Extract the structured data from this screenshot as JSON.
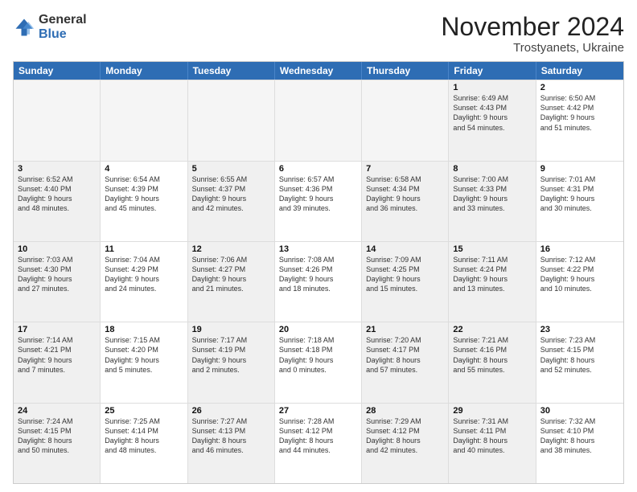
{
  "logo": {
    "general": "General",
    "blue": "Blue"
  },
  "title": "November 2024",
  "subtitle": "Trostyanets, Ukraine",
  "header_days": [
    "Sunday",
    "Monday",
    "Tuesday",
    "Wednesday",
    "Thursday",
    "Friday",
    "Saturday"
  ],
  "rows": [
    [
      {
        "day": "",
        "info": "",
        "empty": true
      },
      {
        "day": "",
        "info": "",
        "empty": true
      },
      {
        "day": "",
        "info": "",
        "empty": true
      },
      {
        "day": "",
        "info": "",
        "empty": true
      },
      {
        "day": "",
        "info": "",
        "empty": true
      },
      {
        "day": "1",
        "info": "Sunrise: 6:49 AM\nSunset: 4:43 PM\nDaylight: 9 hours\nand 54 minutes.",
        "shaded": true
      },
      {
        "day": "2",
        "info": "Sunrise: 6:50 AM\nSunset: 4:42 PM\nDaylight: 9 hours\nand 51 minutes.",
        "shaded": false
      }
    ],
    [
      {
        "day": "3",
        "info": "Sunrise: 6:52 AM\nSunset: 4:40 PM\nDaylight: 9 hours\nand 48 minutes.",
        "shaded": true
      },
      {
        "day": "4",
        "info": "Sunrise: 6:54 AM\nSunset: 4:39 PM\nDaylight: 9 hours\nand 45 minutes.",
        "shaded": false
      },
      {
        "day": "5",
        "info": "Sunrise: 6:55 AM\nSunset: 4:37 PM\nDaylight: 9 hours\nand 42 minutes.",
        "shaded": true
      },
      {
        "day": "6",
        "info": "Sunrise: 6:57 AM\nSunset: 4:36 PM\nDaylight: 9 hours\nand 39 minutes.",
        "shaded": false
      },
      {
        "day": "7",
        "info": "Sunrise: 6:58 AM\nSunset: 4:34 PM\nDaylight: 9 hours\nand 36 minutes.",
        "shaded": true
      },
      {
        "day": "8",
        "info": "Sunrise: 7:00 AM\nSunset: 4:33 PM\nDaylight: 9 hours\nand 33 minutes.",
        "shaded": true
      },
      {
        "day": "9",
        "info": "Sunrise: 7:01 AM\nSunset: 4:31 PM\nDaylight: 9 hours\nand 30 minutes.",
        "shaded": false
      }
    ],
    [
      {
        "day": "10",
        "info": "Sunrise: 7:03 AM\nSunset: 4:30 PM\nDaylight: 9 hours\nand 27 minutes.",
        "shaded": true
      },
      {
        "day": "11",
        "info": "Sunrise: 7:04 AM\nSunset: 4:29 PM\nDaylight: 9 hours\nand 24 minutes.",
        "shaded": false
      },
      {
        "day": "12",
        "info": "Sunrise: 7:06 AM\nSunset: 4:27 PM\nDaylight: 9 hours\nand 21 minutes.",
        "shaded": true
      },
      {
        "day": "13",
        "info": "Sunrise: 7:08 AM\nSunset: 4:26 PM\nDaylight: 9 hours\nand 18 minutes.",
        "shaded": false
      },
      {
        "day": "14",
        "info": "Sunrise: 7:09 AM\nSunset: 4:25 PM\nDaylight: 9 hours\nand 15 minutes.",
        "shaded": true
      },
      {
        "day": "15",
        "info": "Sunrise: 7:11 AM\nSunset: 4:24 PM\nDaylight: 9 hours\nand 13 minutes.",
        "shaded": true
      },
      {
        "day": "16",
        "info": "Sunrise: 7:12 AM\nSunset: 4:22 PM\nDaylight: 9 hours\nand 10 minutes.",
        "shaded": false
      }
    ],
    [
      {
        "day": "17",
        "info": "Sunrise: 7:14 AM\nSunset: 4:21 PM\nDaylight: 9 hours\nand 7 minutes.",
        "shaded": true
      },
      {
        "day": "18",
        "info": "Sunrise: 7:15 AM\nSunset: 4:20 PM\nDaylight: 9 hours\nand 5 minutes.",
        "shaded": false
      },
      {
        "day": "19",
        "info": "Sunrise: 7:17 AM\nSunset: 4:19 PM\nDaylight: 9 hours\nand 2 minutes.",
        "shaded": true
      },
      {
        "day": "20",
        "info": "Sunrise: 7:18 AM\nSunset: 4:18 PM\nDaylight: 9 hours\nand 0 minutes.",
        "shaded": false
      },
      {
        "day": "21",
        "info": "Sunrise: 7:20 AM\nSunset: 4:17 PM\nDaylight: 8 hours\nand 57 minutes.",
        "shaded": true
      },
      {
        "day": "22",
        "info": "Sunrise: 7:21 AM\nSunset: 4:16 PM\nDaylight: 8 hours\nand 55 minutes.",
        "shaded": true
      },
      {
        "day": "23",
        "info": "Sunrise: 7:23 AM\nSunset: 4:15 PM\nDaylight: 8 hours\nand 52 minutes.",
        "shaded": false
      }
    ],
    [
      {
        "day": "24",
        "info": "Sunrise: 7:24 AM\nSunset: 4:15 PM\nDaylight: 8 hours\nand 50 minutes.",
        "shaded": true
      },
      {
        "day": "25",
        "info": "Sunrise: 7:25 AM\nSunset: 4:14 PM\nDaylight: 8 hours\nand 48 minutes.",
        "shaded": false
      },
      {
        "day": "26",
        "info": "Sunrise: 7:27 AM\nSunset: 4:13 PM\nDaylight: 8 hours\nand 46 minutes.",
        "shaded": true
      },
      {
        "day": "27",
        "info": "Sunrise: 7:28 AM\nSunset: 4:12 PM\nDaylight: 8 hours\nand 44 minutes.",
        "shaded": false
      },
      {
        "day": "28",
        "info": "Sunrise: 7:29 AM\nSunset: 4:12 PM\nDaylight: 8 hours\nand 42 minutes.",
        "shaded": true
      },
      {
        "day": "29",
        "info": "Sunrise: 7:31 AM\nSunset: 4:11 PM\nDaylight: 8 hours\nand 40 minutes.",
        "shaded": true
      },
      {
        "day": "30",
        "info": "Sunrise: 7:32 AM\nSunset: 4:10 PM\nDaylight: 8 hours\nand 38 minutes.",
        "shaded": false
      }
    ]
  ]
}
